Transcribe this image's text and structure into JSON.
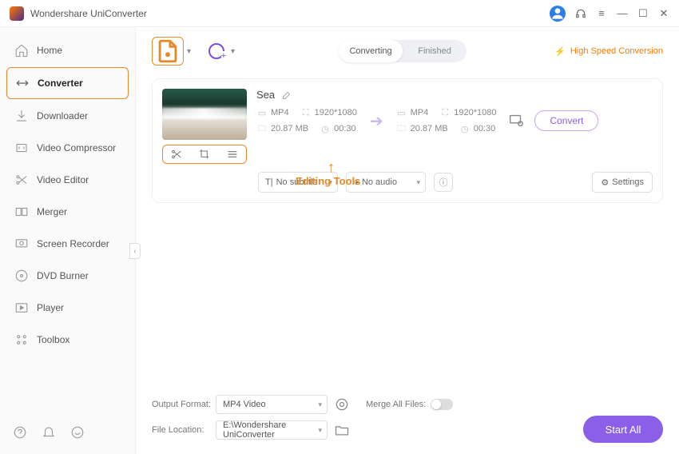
{
  "app": {
    "title": "Wondershare UniConverter"
  },
  "sidebar": {
    "items": [
      {
        "label": "Home"
      },
      {
        "label": "Converter"
      },
      {
        "label": "Downloader"
      },
      {
        "label": "Video Compressor"
      },
      {
        "label": "Video Editor"
      },
      {
        "label": "Merger"
      },
      {
        "label": "Screen Recorder"
      },
      {
        "label": "DVD Burner"
      },
      {
        "label": "Player"
      },
      {
        "label": "Toolbox"
      }
    ]
  },
  "tabs": {
    "converting": "Converting",
    "finished": "Finished"
  },
  "speed_link": "High Speed Conversion",
  "file": {
    "name": "Sea",
    "src": {
      "format": "MP4",
      "res": "1920*1080",
      "size": "20.87 MB",
      "dur": "00:30"
    },
    "dst": {
      "format": "MP4",
      "res": "1920*1080",
      "size": "20.87 MB",
      "dur": "00:30"
    },
    "convert_label": "Convert",
    "subtitle": "No subtitle",
    "audio": "No audio",
    "settings_label": "Settings"
  },
  "annotation": {
    "label": "Editing Tools"
  },
  "bottom": {
    "output_format_label": "Output Format:",
    "output_format_value": "MP4 Video",
    "file_location_label": "File Location:",
    "file_location_value": "E:\\Wondershare UniConverter",
    "merge_label": "Merge All Files:",
    "start_all": "Start All"
  }
}
